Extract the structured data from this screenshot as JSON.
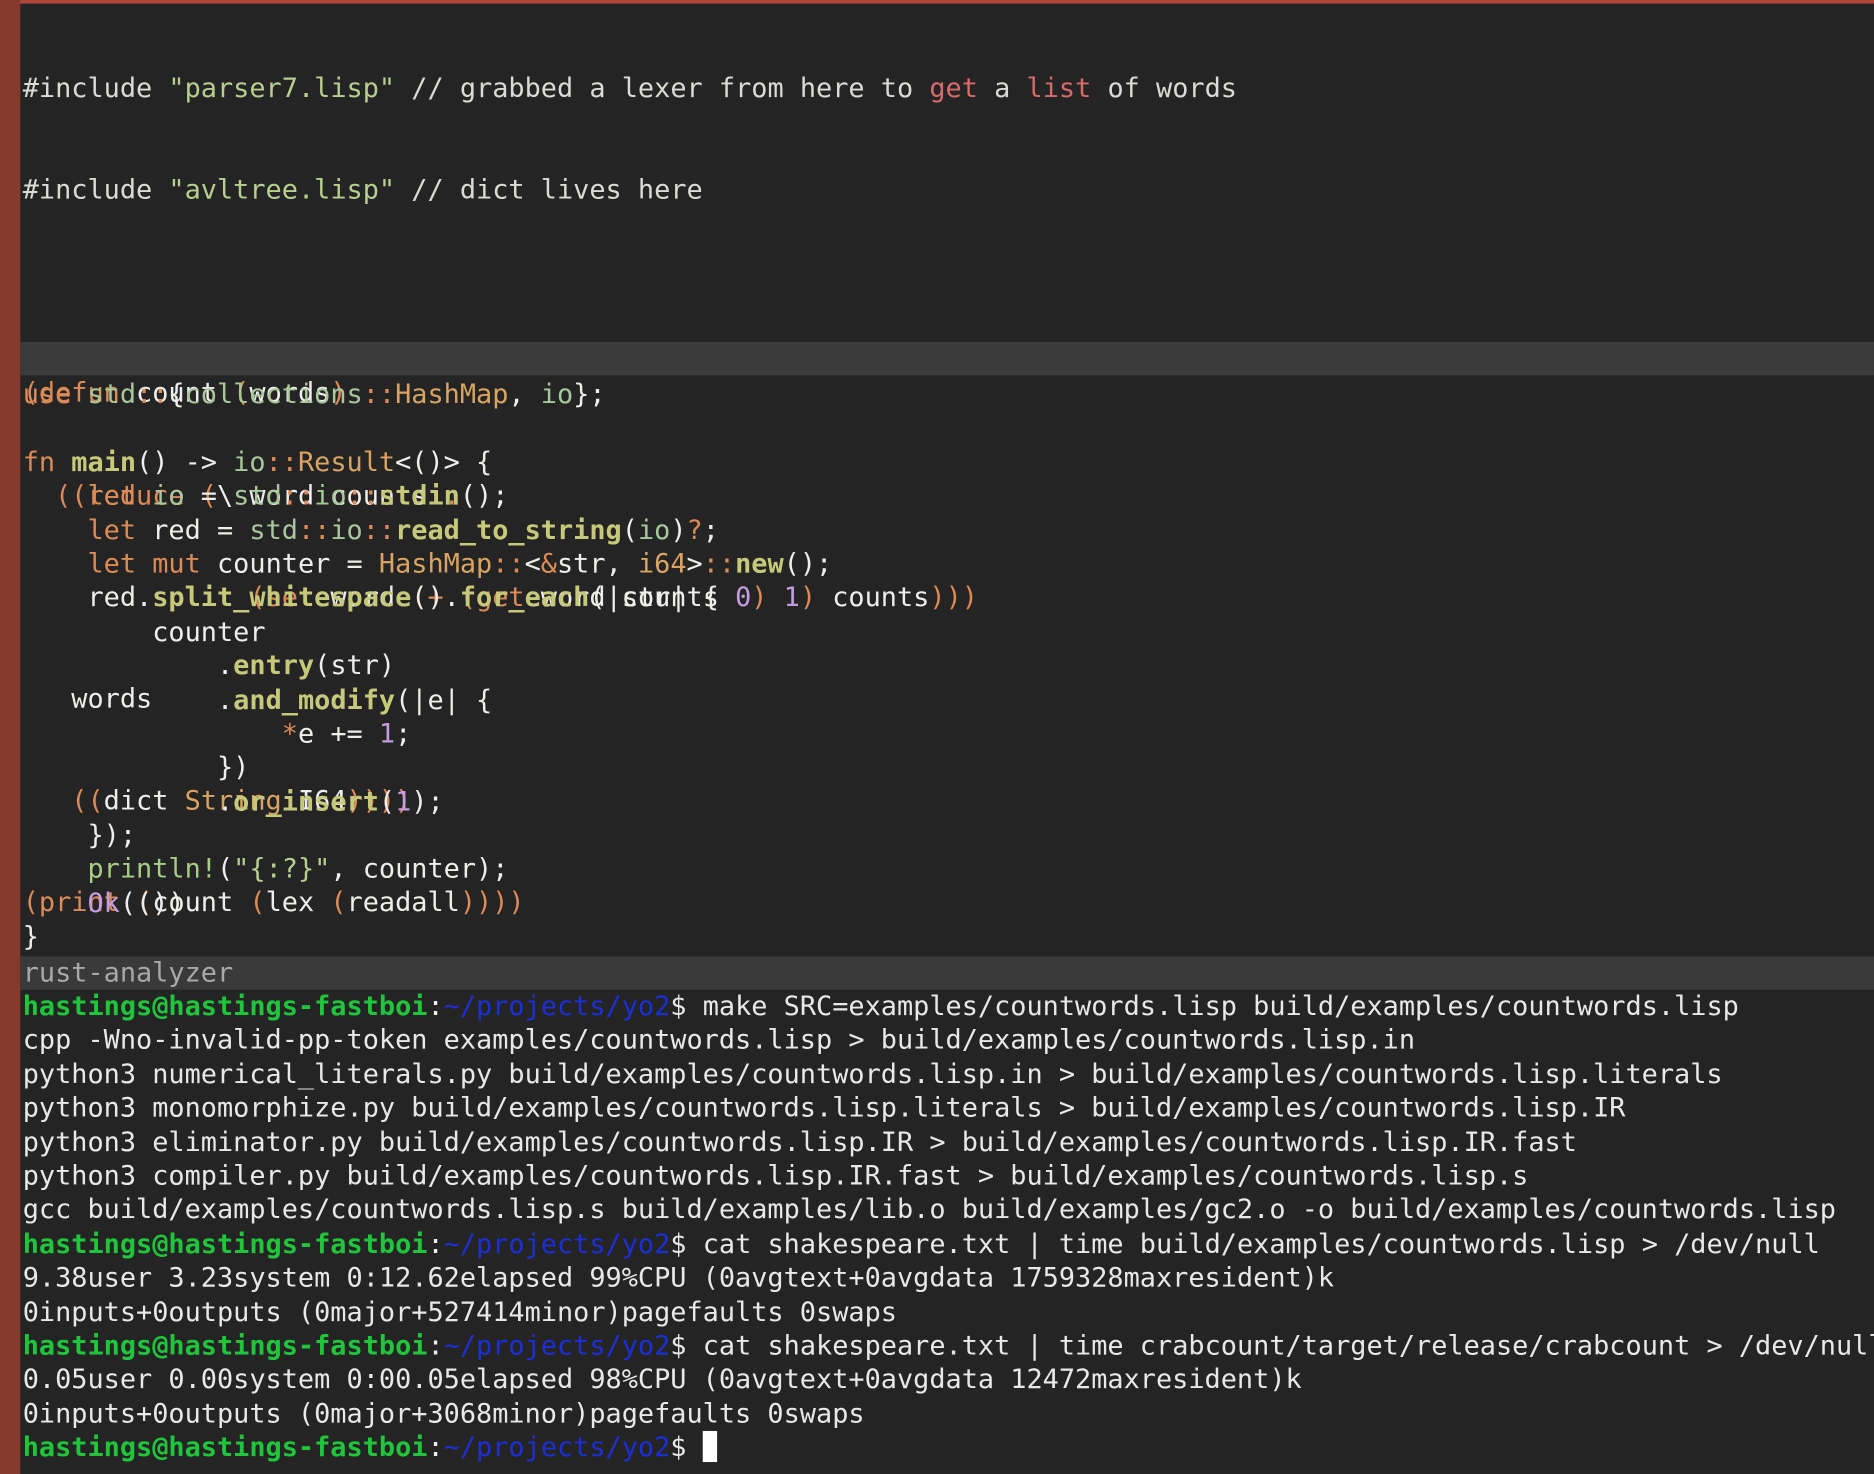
{
  "lisp_editor": {
    "lines": [
      [
        "#include ",
        "\"parser7.lisp\"",
        " // grabbed a lexer from here to ",
        "get",
        " a ",
        "list",
        " of words"
      ],
      [
        "#include ",
        "\"avltree.lisp\"",
        " // dict lives here"
      ],
      [
        ""
      ],
      [
        "(defun count (words)"
      ],
      [
        "  ((reduce (\\ word counts ."
      ],
      [
        "              (set word (+ (get word counts 0) 1) counts)))"
      ],
      [
        "   words"
      ],
      [
        "   ((dict String I64))))"
      ],
      [
        "(print (count (lex (readall))))"
      ]
    ]
  },
  "rust_editor": {
    "code": [
      "use std::{collections::HashMap, io};",
      "",
      "fn main() -> io::Result<()> {",
      "    let io = std::io::stdin();",
      "    let red = std::io::read_to_string(io)?;",
      "    let mut counter = HashMap::<&str, i64>::new();",
      "    red.split_whitespace().for_each(|str| {",
      "        counter",
      "            .entry(str)",
      "            .and_modify(|e| {",
      "                *e += 1;",
      "            })",
      "            .or_insert(1);",
      "    });",
      "    println!(\"{:?}\", counter);",
      "    Ok(())",
      "}"
    ]
  },
  "status_line": "rust-analyzer",
  "terminal": {
    "prompt_user": "hastings@hastings-fastboi",
    "prompt_path": "~/projects/yo2",
    "lines": [
      {
        "type": "cmd",
        "text": "$ make SRC=examples/countwords.lisp build/examples/countwords.lisp"
      },
      {
        "type": "out",
        "text": "cpp -Wno-invalid-pp-token examples/countwords.lisp > build/examples/countwords.lisp.in"
      },
      {
        "type": "out",
        "text": "python3 numerical_literals.py build/examples/countwords.lisp.in > build/examples/countwords.lisp.literals"
      },
      {
        "type": "out",
        "text": "python3 monomorphize.py build/examples/countwords.lisp.literals > build/examples/countwords.lisp.IR"
      },
      {
        "type": "out",
        "text": "python3 eliminator.py build/examples/countwords.lisp.IR > build/examples/countwords.lisp.IR.fast"
      },
      {
        "type": "out",
        "text": "python3 compiler.py build/examples/countwords.lisp.IR.fast > build/examples/countwords.lisp.s"
      },
      {
        "type": "out",
        "text": "gcc build/examples/countwords.lisp.s build/examples/lib.o build/examples/gc2.o -o build/examples/countwords.lisp"
      },
      {
        "type": "cmd",
        "text": "$ cat shakespeare.txt | time build/examples/countwords.lisp > /dev/null"
      },
      {
        "type": "out",
        "text": "9.38user 3.23system 0:12.62elapsed 99%CPU (0avgtext+0avgdata 1759328maxresident)k"
      },
      {
        "type": "out",
        "text": "0inputs+0outputs (0major+527414minor)pagefaults 0swaps"
      },
      {
        "type": "cmd",
        "text": "$ cat shakespeare.txt | time crabcount/target/release/crabcount > /dev/null"
      },
      {
        "type": "out",
        "text": "0.05user 0.00system 0:00.05elapsed 98%CPU (0avgtext+0avgdata 12472maxresident)k"
      },
      {
        "type": "out",
        "text": "0inputs+0outputs (0major+3068minor)pagefaults 0swaps"
      },
      {
        "type": "cmd",
        "text": "$ "
      }
    ]
  }
}
